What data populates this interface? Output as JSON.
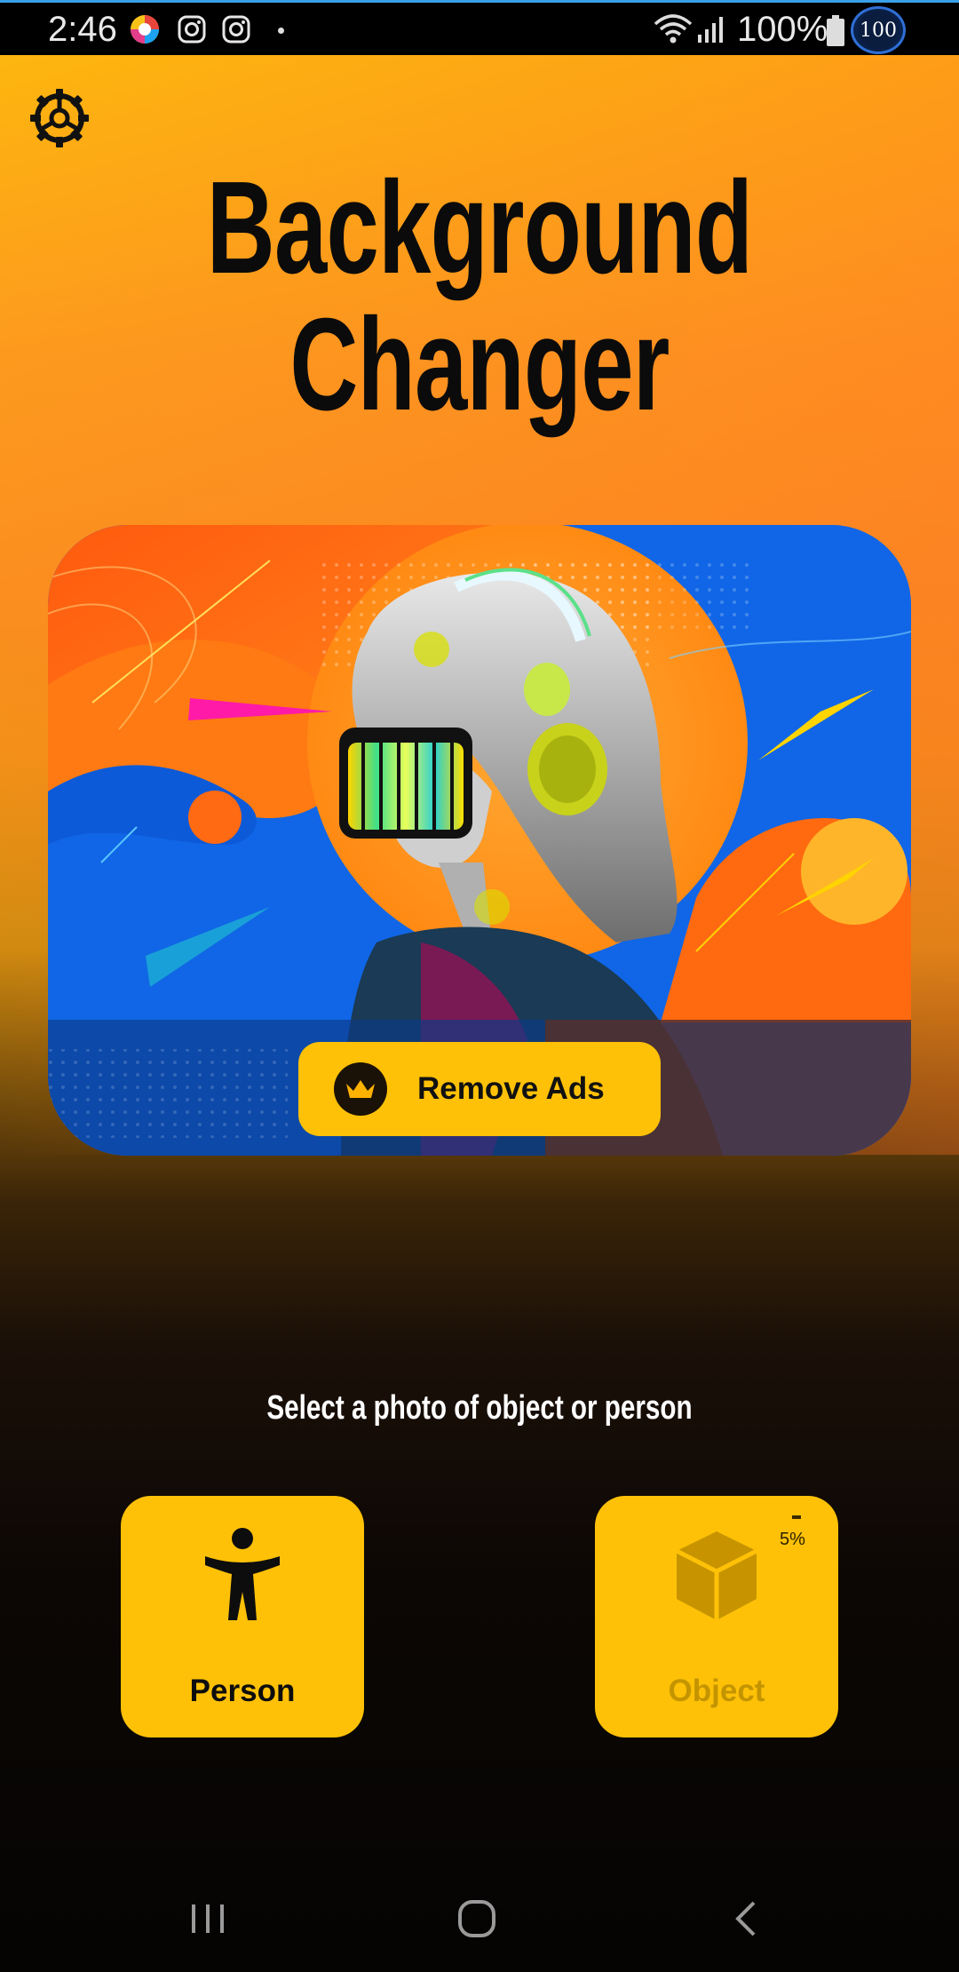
{
  "status_bar": {
    "time": "2:46",
    "battery_percent": "100%",
    "badge": "100",
    "icons": [
      "chrome-like-app-icon",
      "instagram-icon",
      "instagram-icon",
      "dot-indicator",
      "wifi-icon",
      "signal-icon",
      "battery-icon"
    ]
  },
  "header": {
    "settings_icon": "gear-icon",
    "title_line1": "Background",
    "title_line2": "Changer"
  },
  "banner": {
    "image": "woman-with-headphones-and-visor-illustration",
    "remove_ads_label": "Remove Ads",
    "remove_ads_icon": "crown-icon"
  },
  "main": {
    "prompt": "Select a photo of object or person",
    "cards": [
      {
        "label": "Person",
        "icon": "person-icon",
        "enabled": true
      },
      {
        "label": "Object",
        "icon": "cube-icon",
        "enabled": false,
        "progress": "5%"
      }
    ]
  },
  "nav": {
    "recents_icon": "recents-icon",
    "home_icon": "home-icon",
    "back_icon": "back-icon"
  },
  "colors": {
    "accent": "#fec107",
    "title": "#0b0b0b",
    "banner_blue": "#1066e6",
    "banner_orange": "#ff6a12"
  }
}
